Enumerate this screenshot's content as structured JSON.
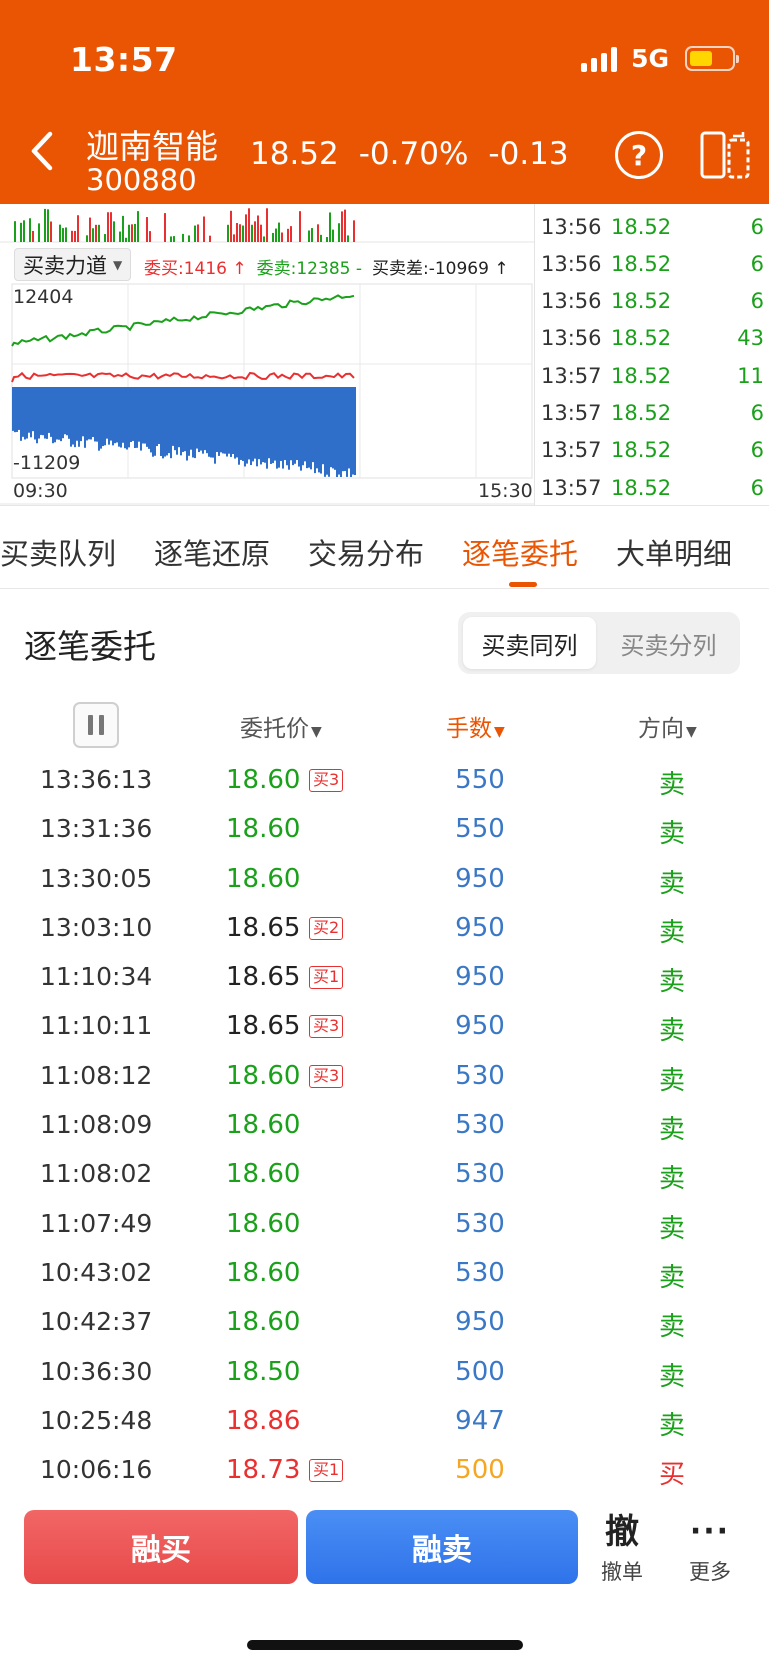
{
  "status": {
    "time": "13:57",
    "network": "5G"
  },
  "header": {
    "stock_name": "迦南智能",
    "stock_code": "300880",
    "price": "18.52",
    "change_pct": "-0.70%",
    "change": "-0.13",
    "help_label": "?"
  },
  "chart": {
    "tab_label": "买卖力道",
    "stat_buy": "委买:1416 ↑",
    "stat_sell": "委卖:12385 -",
    "stat_diff": "买卖差:-10969 ↑",
    "y_top": "12404",
    "y_bottom": "-11209",
    "x_start": "09:30",
    "x_end": "15:30"
  },
  "ticks": [
    {
      "time": "13:56",
      "price": "18.52",
      "vol": "6"
    },
    {
      "time": "13:56",
      "price": "18.52",
      "vol": "6"
    },
    {
      "time": "13:56",
      "price": "18.52",
      "vol": "6"
    },
    {
      "time": "13:56",
      "price": "18.52",
      "vol": "43"
    },
    {
      "time": "13:57",
      "price": "18.52",
      "vol": "11"
    },
    {
      "time": "13:57",
      "price": "18.52",
      "vol": "6"
    },
    {
      "time": "13:57",
      "price": "18.52",
      "vol": "6"
    },
    {
      "time": "13:57",
      "price": "18.52",
      "vol": "6"
    }
  ],
  "tabs": [
    "买卖队列",
    "逐笔还原",
    "交易分布",
    "逐笔委托",
    "大单明细"
  ],
  "section": {
    "title": "逐笔委托",
    "seg_same": "买卖同列",
    "seg_split": "买卖分列"
  },
  "columns": {
    "price": "委托价",
    "qty": "手数",
    "dir": "方向"
  },
  "rows": [
    {
      "time": "13:36:13",
      "price": "18.60",
      "tag": "买3",
      "qty": "550",
      "dir": "卖"
    },
    {
      "time": "13:31:36",
      "price": "18.60",
      "tag": "",
      "qty": "550",
      "dir": "卖"
    },
    {
      "time": "13:30:05",
      "price": "18.60",
      "tag": "",
      "qty": "950",
      "dir": "卖"
    },
    {
      "time": "13:03:10",
      "price": "18.65",
      "tag": "买2",
      "qty": "950",
      "dir": "卖"
    },
    {
      "time": "11:10:34",
      "price": "18.65",
      "tag": "买1",
      "qty": "950",
      "dir": "卖"
    },
    {
      "time": "11:10:11",
      "price": "18.65",
      "tag": "买3",
      "qty": "950",
      "dir": "卖"
    },
    {
      "time": "11:08:12",
      "price": "18.60",
      "tag": "买3",
      "qty": "530",
      "dir": "卖"
    },
    {
      "time": "11:08:09",
      "price": "18.60",
      "tag": "",
      "qty": "530",
      "dir": "卖"
    },
    {
      "time": "11:08:02",
      "price": "18.60",
      "tag": "",
      "qty": "530",
      "dir": "卖"
    },
    {
      "time": "11:07:49",
      "price": "18.60",
      "tag": "",
      "qty": "530",
      "dir": "卖"
    },
    {
      "time": "10:43:02",
      "price": "18.60",
      "tag": "",
      "qty": "530",
      "dir": "卖"
    },
    {
      "time": "10:42:37",
      "price": "18.60",
      "tag": "",
      "qty": "950",
      "dir": "卖"
    },
    {
      "time": "10:36:30",
      "price": "18.50",
      "tag": "",
      "qty": "500",
      "dir": "卖"
    },
    {
      "time": "10:25:48",
      "price": "18.86",
      "tag": "",
      "qty": "947",
      "dir": "卖"
    },
    {
      "time": "10:06:16",
      "price": "18.73",
      "tag": "买1",
      "qty": "500",
      "dir": "买"
    }
  ],
  "row_colors": {
    "price": [
      "green",
      "green",
      "green",
      "black",
      "black",
      "black",
      "green",
      "green",
      "green",
      "green",
      "green",
      "green",
      "green",
      "red",
      "red"
    ],
    "qty": [
      "blue",
      "blue",
      "blue",
      "blue",
      "blue",
      "blue",
      "blue",
      "blue",
      "blue",
      "blue",
      "blue",
      "blue",
      "blue",
      "blue",
      "orange"
    ],
    "dir": [
      "green",
      "green",
      "green",
      "green",
      "green",
      "green",
      "green",
      "green",
      "green",
      "green",
      "green",
      "green",
      "green",
      "green",
      "red"
    ]
  },
  "bottom": {
    "buy_label": "融买",
    "sell_label": "融卖",
    "cancel_glyph": "撤",
    "cancel_label": "撤单",
    "more_glyph": "···",
    "more_label": "更多"
  },
  "colors": {
    "brand": "#ea5504",
    "up": "#e93030",
    "down": "#1aa01a",
    "qty": "#3a78c6",
    "sell_btn": "#2f73ea",
    "buy_btn": "#e84a4a"
  },
  "icons": [
    "back-icon",
    "help-icon",
    "switch-layout-icon",
    "pause-icon"
  ]
}
